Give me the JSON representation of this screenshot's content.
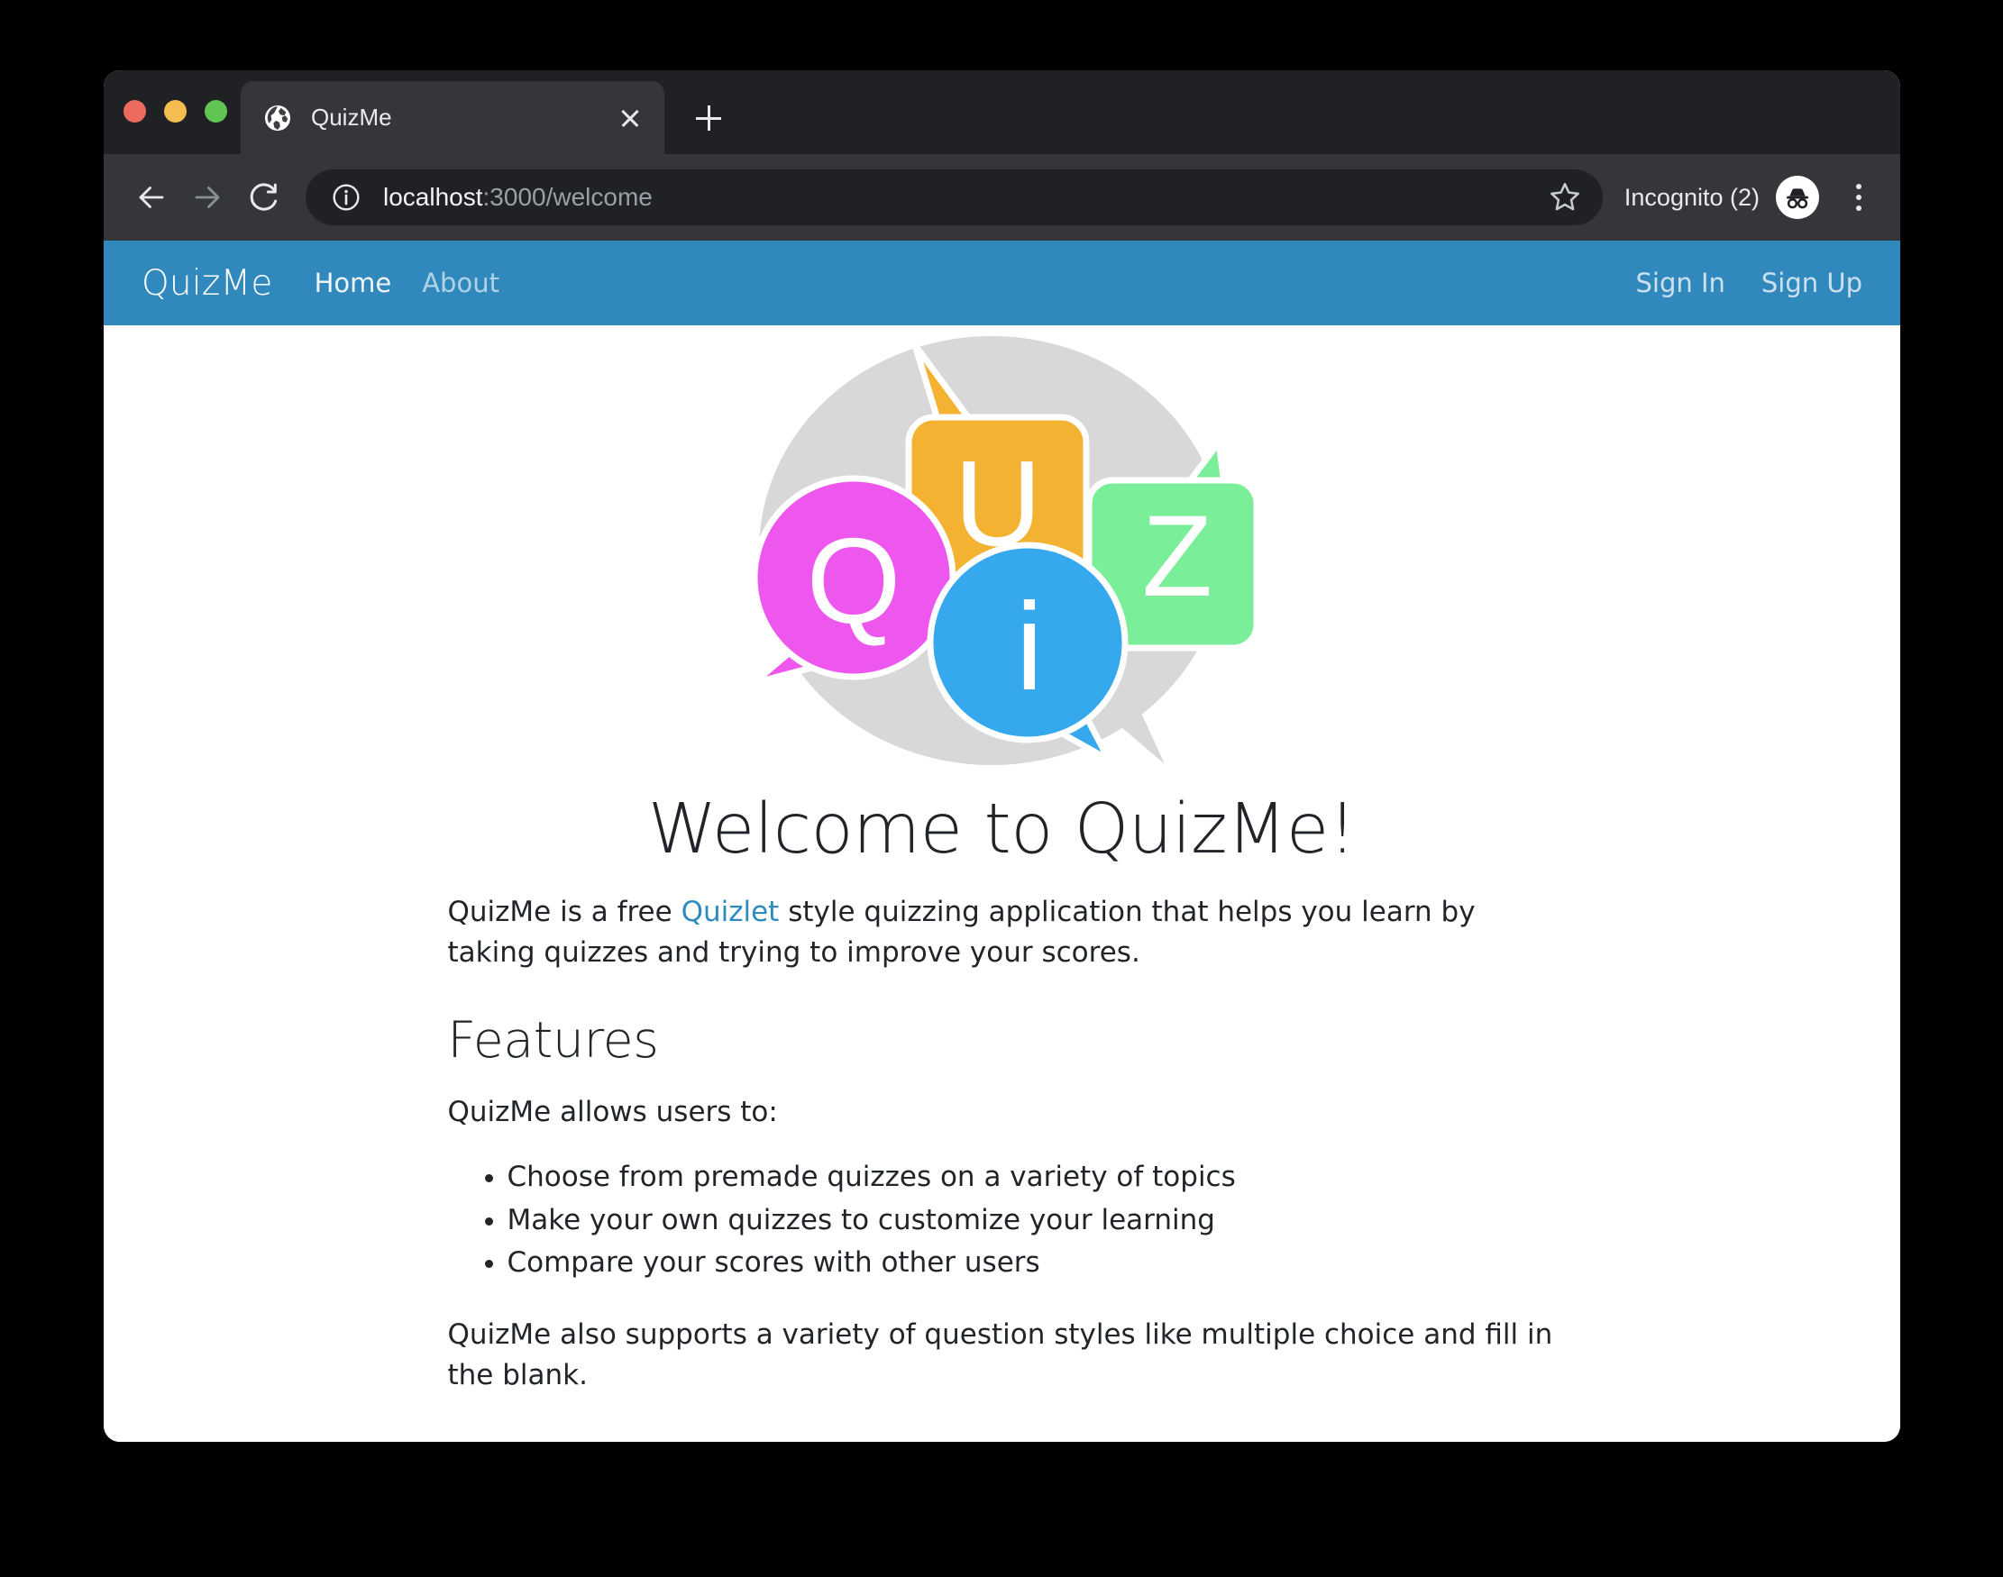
{
  "browser": {
    "traffic_lights": [
      "close",
      "minimize",
      "zoom"
    ],
    "tab": {
      "title": "QuizMe",
      "favicon": "globe-icon",
      "close_label": "×"
    },
    "new_tab_label": "+",
    "toolbar": {
      "back_label": "Back",
      "forward_label": "Forward",
      "reload_label": "Reload",
      "site_info_label": "Site information",
      "url_host": "localhost",
      "url_path": ":3000/welcome",
      "bookmark_label": "Bookmark this tab",
      "profile_label": "Incognito (2)",
      "menu_label": "Customize and control"
    }
  },
  "site": {
    "navbar": {
      "brand": "QuizMe",
      "left_links": [
        {
          "label": "Home",
          "active": true
        },
        {
          "label": "About",
          "active": false
        }
      ],
      "right_links": [
        {
          "label": "Sign In"
        },
        {
          "label": "Sign Up"
        }
      ]
    },
    "logo": {
      "alt": "QuizMe speech bubble logo",
      "letters": [
        "Q",
        "U",
        "i",
        "Z"
      ],
      "colors": {
        "backdrop": "#D8D8D8",
        "q_bubble": "#EE57EE",
        "u_bubble": "#F4B233",
        "i_bubble": "#36A9EE",
        "z_bubble": "#7BEE9A",
        "outline": "#FFFFFF"
      }
    },
    "main": {
      "title": "Welcome to QuizMe!",
      "intro_before": "QuizMe is a free ",
      "intro_link": "Quizlet",
      "intro_after": " style quizzing application that helps you learn by taking quizzes and trying to improve your scores.",
      "features_heading": "Features",
      "features_intro": "QuizMe allows users to:",
      "features": [
        "Choose from premade quizzes on a variety of topics",
        "Make your own quizzes to customize your learning",
        "Compare your scores with other users"
      ],
      "closing": "QuizMe also supports a variety of question styles like multiple choice and fill in the blank."
    }
  },
  "colors": {
    "navbar_blue": "#3088BD",
    "link_blue": "#2D8BC0",
    "browser_tabstrip": "#202124",
    "browser_toolbar": "#35363A",
    "text": "#212529"
  }
}
